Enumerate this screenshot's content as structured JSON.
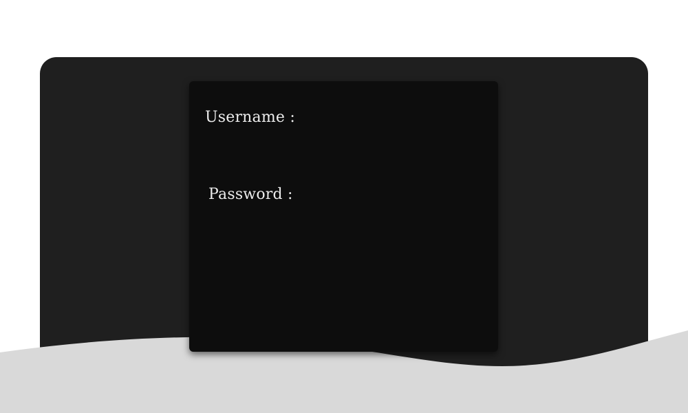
{
  "login_form": {
    "username_label": "Username :",
    "password_label": "Password :",
    "username_value": "",
    "password_value": ""
  },
  "colors": {
    "page_background": "#ffffff",
    "backdrop": "#1f1f1f",
    "card": "#0d0d0d",
    "wave": "#d9d9d9",
    "label_text": "#ededed"
  }
}
